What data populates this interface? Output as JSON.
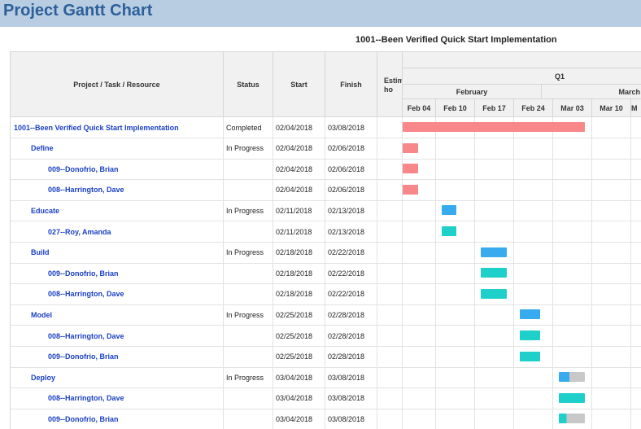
{
  "app_title": "Project Gantt Chart",
  "report_title": "1001--Been Verified Quick Start Implementation",
  "columns": {
    "name": "Project / Task / Resource",
    "status": "Status",
    "start": "Start",
    "finish": "Finish",
    "estimated_line1": "Estim",
    "estimated_line2": "ho"
  },
  "timeline": {
    "quarter": "Q1",
    "months": [
      "February",
      "March"
    ],
    "weeks": [
      "Feb 04",
      "Feb 10",
      "Feb 17",
      "Feb 24",
      "Mar 03",
      "Mar 10",
      "M"
    ]
  },
  "colors": {
    "completed": "#f78789",
    "in_progress": "#38aaee",
    "resource": "#1fcfc9",
    "remaining": "#c8c8c8"
  },
  "rows": [
    {
      "name": "1001--Been Verified Quick Start Implementation",
      "level": 0,
      "status": "Completed",
      "start": "02/04/2018",
      "finish": "03/08/2018",
      "bar": {
        "color": "completed",
        "from": "2018-02-04",
        "to": "2018-03-08"
      }
    },
    {
      "name": "Define",
      "level": 1,
      "status": "In Progress",
      "start": "02/04/2018",
      "finish": "02/06/2018",
      "bar": {
        "color": "completed",
        "from": "2018-02-04",
        "to": "2018-02-06"
      }
    },
    {
      "name": "009--Donofrio, Brian",
      "level": 2,
      "status": "",
      "start": "02/04/2018",
      "finish": "02/06/2018",
      "bar": {
        "color": "completed",
        "from": "2018-02-04",
        "to": "2018-02-06"
      }
    },
    {
      "name": "008--Harrington, Dave",
      "level": 2,
      "status": "",
      "start": "02/04/2018",
      "finish": "02/06/2018",
      "bar": {
        "color": "completed",
        "from": "2018-02-04",
        "to": "2018-02-06"
      }
    },
    {
      "name": "Educate",
      "level": 1,
      "status": "In Progress",
      "start": "02/11/2018",
      "finish": "02/13/2018",
      "bar": {
        "color": "in_progress",
        "from": "2018-02-11",
        "to": "2018-02-13"
      }
    },
    {
      "name": "027--Roy, Amanda",
      "level": 2,
      "status": "",
      "start": "02/11/2018",
      "finish": "02/13/2018",
      "bar": {
        "color": "resource",
        "from": "2018-02-11",
        "to": "2018-02-13"
      }
    },
    {
      "name": "Build",
      "level": 1,
      "status": "In Progress",
      "start": "02/18/2018",
      "finish": "02/22/2018",
      "bar": {
        "color": "in_progress",
        "from": "2018-02-18",
        "to": "2018-02-22"
      }
    },
    {
      "name": "009--Donofrio, Brian",
      "level": 2,
      "status": "",
      "start": "02/18/2018",
      "finish": "02/22/2018",
      "bar": {
        "color": "resource",
        "from": "2018-02-18",
        "to": "2018-02-22"
      }
    },
    {
      "name": "008--Harrington, Dave",
      "level": 2,
      "status": "",
      "start": "02/18/2018",
      "finish": "02/22/2018",
      "bar": {
        "color": "resource",
        "from": "2018-02-18",
        "to": "2018-02-22"
      }
    },
    {
      "name": "Model",
      "level": 1,
      "status": "In Progress",
      "start": "02/25/2018",
      "finish": "02/28/2018",
      "bar": {
        "color": "in_progress",
        "from": "2018-02-25",
        "to": "2018-02-28"
      }
    },
    {
      "name": "008--Harrington, Dave",
      "level": 2,
      "status": "",
      "start": "02/25/2018",
      "finish": "02/28/2018",
      "bar": {
        "color": "resource",
        "from": "2018-02-25",
        "to": "2018-02-28"
      }
    },
    {
      "name": "009--Donofrio, Brian",
      "level": 2,
      "status": "",
      "start": "02/25/2018",
      "finish": "02/28/2018",
      "bar": {
        "color": "resource",
        "from": "2018-02-25",
        "to": "2018-02-28"
      }
    },
    {
      "name": "Deploy",
      "level": 1,
      "status": "In Progress",
      "start": "03/04/2018",
      "finish": "03/08/2018",
      "bar": {
        "color": "in_progress",
        "from": "2018-03-04",
        "to": "2018-03-08",
        "progress": 0.4
      }
    },
    {
      "name": "008--Harrington, Dave",
      "level": 2,
      "status": "",
      "start": "03/04/2018",
      "finish": "03/08/2018",
      "bar": {
        "color": "resource",
        "from": "2018-03-04",
        "to": "2018-03-08"
      }
    },
    {
      "name": "009--Donofrio, Brian",
      "level": 2,
      "status": "",
      "start": "03/04/2018",
      "finish": "03/08/2018",
      "bar": {
        "color": "resource",
        "from": "2018-03-04",
        "to": "2018-03-08",
        "progress": 0.3
      }
    }
  ]
}
